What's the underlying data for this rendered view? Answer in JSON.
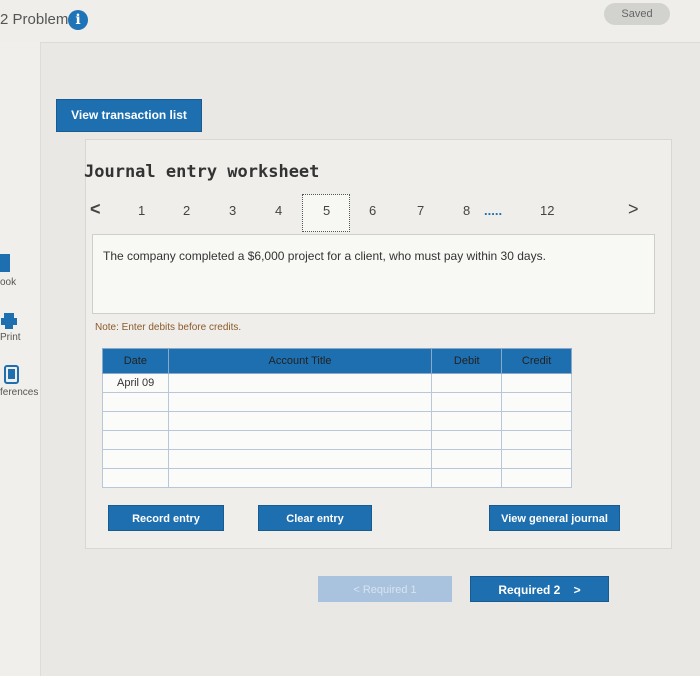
{
  "header": {
    "problem_label": "2 Problem",
    "info_icon": "i",
    "saved_label": "Saved"
  },
  "sidebar": {
    "items": [
      {
        "label": "ook",
        "icon": "book-icon"
      },
      {
        "label": "Print",
        "icon": "printer-icon"
      },
      {
        "label": "ferences",
        "icon": "references-icon"
      }
    ]
  },
  "toolbar": {
    "view_transaction_list": "View transaction list"
  },
  "worksheet": {
    "title": "Journal entry worksheet",
    "prev_arrow": "<",
    "next_arrow": ">",
    "pages": [
      "1",
      "2",
      "3",
      "4",
      "5",
      "6",
      "7",
      "8",
      ".....",
      "12"
    ],
    "selected_page": "5",
    "description": "The company completed a $6,000 project for a client, who must pay within 30 days.",
    "note": "Note: Enter debits before credits.",
    "table": {
      "headers": [
        "Date",
        "Account Title",
        "Debit",
        "Credit"
      ],
      "rows": [
        [
          "April 09",
          "",
          "",
          ""
        ],
        [
          "",
          "",
          "",
          ""
        ],
        [
          "",
          "",
          "",
          ""
        ],
        [
          "",
          "",
          "",
          ""
        ],
        [
          "",
          "",
          "",
          ""
        ],
        [
          "",
          "",
          "",
          ""
        ]
      ]
    },
    "record_entry": "Record entry",
    "clear_entry": "Clear entry",
    "view_general_journal": "View general journal"
  },
  "navigation": {
    "required1": "< Required 1",
    "required2": "Required 2",
    "required2_arrow": ">"
  },
  "colors": {
    "accent": "#1d6fb0",
    "disabled": "#a9c3de",
    "note": "#8b5a2b"
  }
}
